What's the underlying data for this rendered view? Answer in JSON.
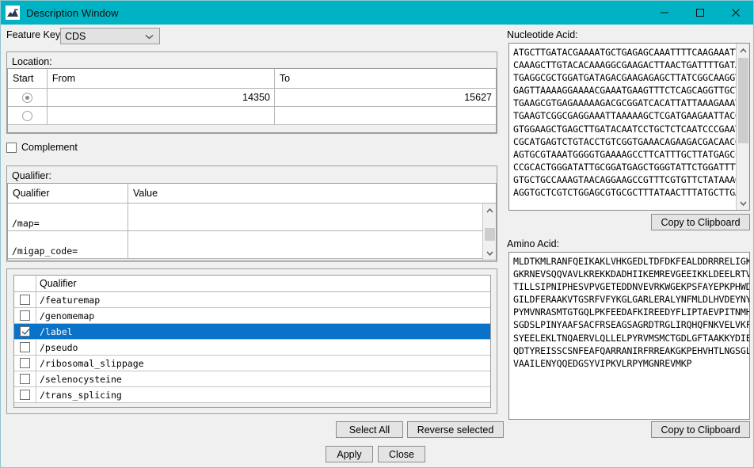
{
  "window": {
    "title": "Description Window",
    "icon": "app-icon",
    "minimize": "—",
    "maximize": "☐",
    "close": "✕",
    "titlebar_color": "#00b3c4"
  },
  "feature_key": {
    "label": "Feature Key:",
    "value": "CDS"
  },
  "location": {
    "label": "Location:",
    "columns": [
      "Start",
      "From",
      "To"
    ],
    "rows": [
      {
        "start_selected": true,
        "from": "14350",
        "to": "15627"
      },
      {
        "start_selected": false,
        "from": "",
        "to": ""
      }
    ]
  },
  "complement": {
    "label": "Complement",
    "checked": false
  },
  "qualifier_table": {
    "label": "Qualifier:",
    "columns": [
      "Qualifier",
      "Value"
    ],
    "rows": [
      {
        "qualifier": "/map=",
        "value": ""
      },
      {
        "qualifier": "/migap_code=",
        "value": ""
      }
    ]
  },
  "qualifier_list": {
    "column": "Qualifier",
    "items": [
      {
        "label": "/featuremap",
        "checked": false,
        "selected": false
      },
      {
        "label": "/genomemap",
        "checked": false,
        "selected": false
      },
      {
        "label": "/label",
        "checked": true,
        "selected": true
      },
      {
        "label": "/pseudo",
        "checked": false,
        "selected": false
      },
      {
        "label": "/ribosomal_slippage",
        "checked": false,
        "selected": false
      },
      {
        "label": "/selenocysteine",
        "checked": false,
        "selected": false
      },
      {
        "label": "/trans_splicing",
        "checked": false,
        "selected": false
      }
    ]
  },
  "list_buttons": {
    "select_all": "Select All",
    "reverse_selected": "Reverse selected"
  },
  "nucleotide": {
    "label": "Nucleotide Acid:",
    "sequence": "ATGCTTGATACGAAAATGCTGAGAGCAAATTTTCAAGAAATTAAAG\nCAAAGCTTGTACACAAAGGCGAAGACTTAACTGATTTTGATAAGTT\nTGAGGCGCTGGATGATAGACGAAGAGAGCTTATCGGCAAGGTTGAA\nGAGTTAAAAGGAAAACGAAATGAAGTTTCTCAGCAGGTTGCTGTGC\nTGAAGCGTGAGAAAAAGACGCGGATCACATTATTAAAGAAATGCG\nTGAAGTCGGCGAGGAAATTAAAAAGCTCGATGAAGAATTACGGACA\nGTGGAAGCTGAGCTTGATACAATCCTGCTCTCAATCCCGAATATTC\nCGCATGAGTCTGTACCTGTCGGTGAAACAGAAGACGACAACGTAGA\nAGTGCGTAAATGGGGTGAAAAGCCTTCATTTGCTTATGAGCCGAAG\nCCGCACTGGGATATTGCGGATGAGCTGGGTATTCTGGATTTTGAAC\nGTGCTGCCAAAGTAACAGGAAGCCGTTTCGTGTTCTATAAAGGCTT\nAGGTGCTCGTCTGGAGCGTGCGCTTTATAACTTTATGCTTGATCTG"
  },
  "amino": {
    "label": "Amino Acid:",
    "sequence": "MLDTKMLRANFQEIKAKLVHKGEDLTDFDKFEALDDRRRELIGKVEELK\nGKRNEVSQQVAVLKREKKDADHIIKEMREVGEEIKKLDEELRTVEAELD\nTILLSIPNIPHESVPVGETEDDNVEVRKWGEKPSFAYEPKPHWDIADEL\nGILDFERAAKVTGSRFVFYKGLGARLERALYNFMLDLHVDEYNYTEVIP\nPYMVNRASMTGTGQLPKFEEDAFKIREEDYFLIPTAEVPITNMHRDEIL\nSGDSLPINYAAFSACFRSEAGSAGRDTRGLIRQHQFNKVELVKFVKPED\nSYEELEKLTNQAERVLQLLELPYRVMSMCTGDLGFTAAKKYDIEVWIPS\nQDTYREISSCSNFEAFQARRANIRFRREAKGKPEHVHTLNGSGLAVGRT\nVAAILENYQQEDGSYVIPKVLRPYMGNREVMKP"
  },
  "copy_buttons": {
    "nucleotide": "Copy to Clipboard",
    "amino": "Copy to Clipboard"
  },
  "dialog_buttons": {
    "apply": "Apply",
    "close": "Close"
  }
}
